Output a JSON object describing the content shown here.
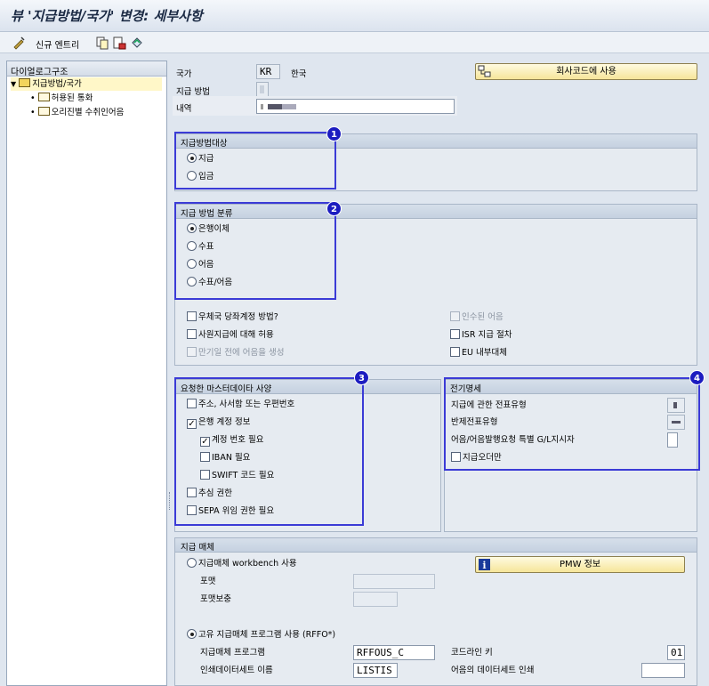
{
  "window": {
    "title": "뷰 '지급방법/국가' 변경: 세부사항"
  },
  "toolbar": {
    "new_entries_label": "신규 엔트리"
  },
  "tree": {
    "header": "다이얼로그구조",
    "items": [
      {
        "label": "지급방법/국가",
        "selected": true,
        "expanded": true
      },
      {
        "label": "허용된 통화"
      },
      {
        "label": "오리진별 수취인어음"
      }
    ]
  },
  "header": {
    "country_label": "국가",
    "country_value": "KR",
    "country_name": "한국",
    "payment_method_label": "지급 방법",
    "description_label": "내역",
    "company_code_button": "회사코드에 사용"
  },
  "payment_for": {
    "title": "지급방법대상",
    "options": [
      "지급",
      "입금"
    ],
    "selected": 0
  },
  "classification": {
    "title": "지급 방법 분류",
    "options": [
      "은행이체",
      "수표",
      "어음",
      "수표/어음"
    ],
    "selected": 0,
    "checks_left": [
      {
        "label": "우체국 당좌계정 방법?",
        "checked": false,
        "enabled": true
      },
      {
        "label": "사원지급에 대해 허용",
        "checked": false,
        "enabled": true
      },
      {
        "label": "만기일 전에 어음을 생성",
        "checked": false,
        "enabled": false
      }
    ],
    "checks_right": [
      {
        "label": "인수된 어음",
        "checked": false,
        "enabled": false
      },
      {
        "label": "ISR 지급 절차",
        "checked": false,
        "enabled": true
      },
      {
        "label": "EU 내부대체",
        "checked": false,
        "enabled": true
      }
    ]
  },
  "master_data": {
    "title": "요청한 마스터데이타 사양",
    "items": [
      {
        "label": "주소, 사서함 또는 우편번호",
        "checked": false,
        "indent": 0
      },
      {
        "label": "은행 계정 정보",
        "checked": true,
        "indent": 0
      },
      {
        "label": "계정 번호 필요",
        "checked": true,
        "indent": 1
      },
      {
        "label": "IBAN 필요",
        "checked": false,
        "indent": 1
      },
      {
        "label": "SWIFT 코드 필요",
        "checked": false,
        "indent": 1
      },
      {
        "label": "추심 권한",
        "checked": false,
        "indent": 0
      },
      {
        "label": "SEPA 위임 권한 필요",
        "checked": false,
        "indent": 0
      }
    ]
  },
  "posting": {
    "title": "전기명세",
    "doc_type_label": "지급에 관한 전표유형",
    "clear_doc_label": "반제전표유형",
    "spgl_label": "어음/어음발행요청 특별 G/L지시자",
    "payment_order_label": "지급오더만"
  },
  "medium": {
    "title": "지급 매체",
    "workbench_option": "지급매체 workbench 사용",
    "format_label": "포맷",
    "format_supp_label": "포맷보충",
    "pmw_button": "PMW 정보",
    "classic_option": "고유 지급매체 프로그램 사용 (RFFO*)",
    "selected": 1,
    "program_label": "지급매체 프로그램",
    "program_value": "RFFOUS_C",
    "key_label": "코드라인 키",
    "key_value": "01",
    "print_label": "인쇄데이터세트 이름",
    "print_value": "LISTIS",
    "note_print_label": "어음의 데이터세트 인쇄"
  },
  "annotations": [
    "1",
    "2",
    "3",
    "4"
  ],
  "colors": {
    "highlight": "#3b3bd6",
    "badge": "#1c1cc0",
    "button": "#f6e59a"
  }
}
